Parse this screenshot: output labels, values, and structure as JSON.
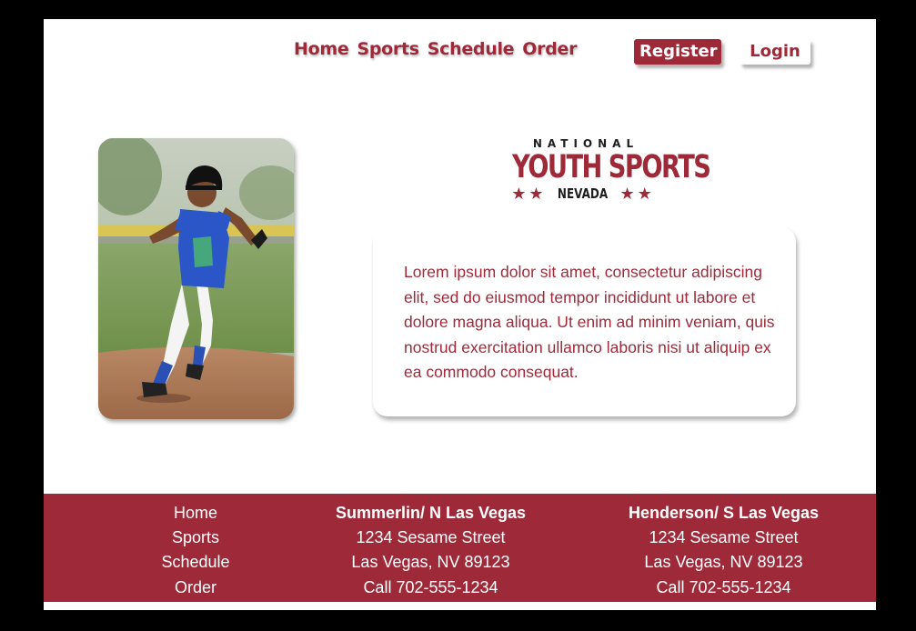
{
  "nav": {
    "links": [
      "Home",
      "Sports",
      "Schedule",
      "Order"
    ],
    "register_label": "Register",
    "login_label": "Login"
  },
  "logo": {
    "top": "NATIONAL",
    "mid": "YOUTH SPORTS",
    "state": "NEVADA",
    "stars": "★★"
  },
  "hero": {
    "image": "youth baseball player running bases",
    "text": "Lorem ipsum dolor sit amet, consectetur adipiscing elit, sed do eiusmod tempor incididunt ut labore et dolore magna aliqua. Ut enim ad minim veniam, quis nostrud exercitation ullamco laboris nisi ut aliquip ex ea commodo consequat."
  },
  "footer": {
    "links": [
      "Home",
      "Sports",
      "Schedule",
      "Order"
    ],
    "locations": [
      {
        "title": "Summerlin/ N Las Vegas",
        "street": "1234 Sesame Street",
        "city": "Las Vegas, NV 89123",
        "phone": "Call 702-555-1234"
      },
      {
        "title": "Henderson/ S Las Vegas",
        "street": "1234 Sesame Street",
        "city": "Las Vegas, NV 89123",
        "phone": "Call 702-555-1234"
      }
    ]
  },
  "colors": {
    "brand": "#9e2a39",
    "background": "#ffffff",
    "frame": "#000000"
  }
}
